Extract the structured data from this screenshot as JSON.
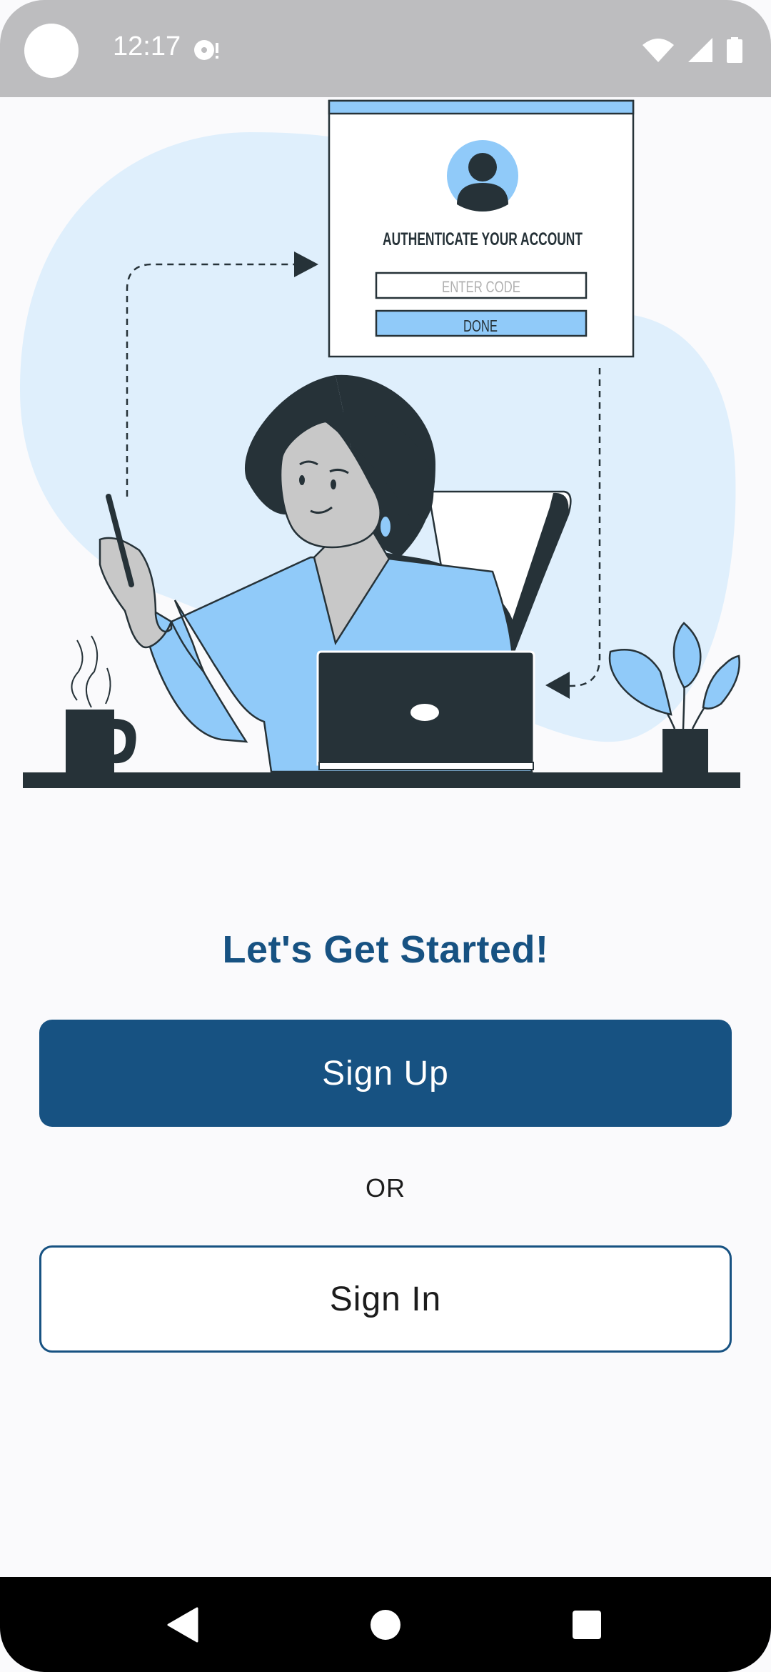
{
  "status_bar": {
    "time": "12:17",
    "icons": [
      "camera-cutout-icon",
      "media-notification-icon",
      "wifi-icon",
      "cellular-signal-icon",
      "battery-icon"
    ]
  },
  "illustration": {
    "card_title": "AUTHENTICATE YOUR ACCOUNT",
    "card_input_placeholder": "ENTER CODE",
    "card_button_label": "DONE"
  },
  "main": {
    "headline": "Let's Get Started!",
    "signup_label": "Sign Up",
    "or_label": "OR",
    "signin_label": "Sign In"
  },
  "nav_bar": {
    "icons": [
      "back-icon",
      "home-icon",
      "recent-apps-icon"
    ]
  },
  "colors": {
    "primary": "#175282",
    "accent_light": "#90caf9",
    "blob": "#dfeffc",
    "dark": "#263238"
  }
}
